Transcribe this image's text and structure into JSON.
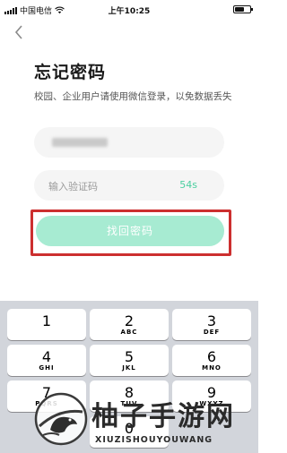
{
  "status_bar": {
    "carrier": "中国电信",
    "time": "上午10:25"
  },
  "page": {
    "title": "忘记密码",
    "subtitle": "校园、企业用户请使用微信登录，以免数据丢失"
  },
  "form": {
    "code_placeholder": "输入验证码",
    "countdown": "54s",
    "submit_label": "找回密码"
  },
  "keyboard": {
    "keys": [
      {
        "num": "1",
        "letters": ""
      },
      {
        "num": "2",
        "letters": "ABC"
      },
      {
        "num": "3",
        "letters": "DEF"
      },
      {
        "num": "4",
        "letters": "GHI"
      },
      {
        "num": "5",
        "letters": "JKL"
      },
      {
        "num": "6",
        "letters": "MNO"
      },
      {
        "num": "7",
        "letters": "PQRS"
      },
      {
        "num": "8",
        "letters": "TUV"
      },
      {
        "num": "9",
        "letters": "WXYZ"
      },
      {
        "num": "0",
        "letters": ""
      }
    ]
  },
  "watermark": {
    "name": "柚子手游网",
    "pinyin": "XIUZISHOUYOUWANG"
  },
  "colors": {
    "accent": "#4bcfa0",
    "button_disabled": "#a7ebd2",
    "highlight": "#cc2f2f"
  }
}
